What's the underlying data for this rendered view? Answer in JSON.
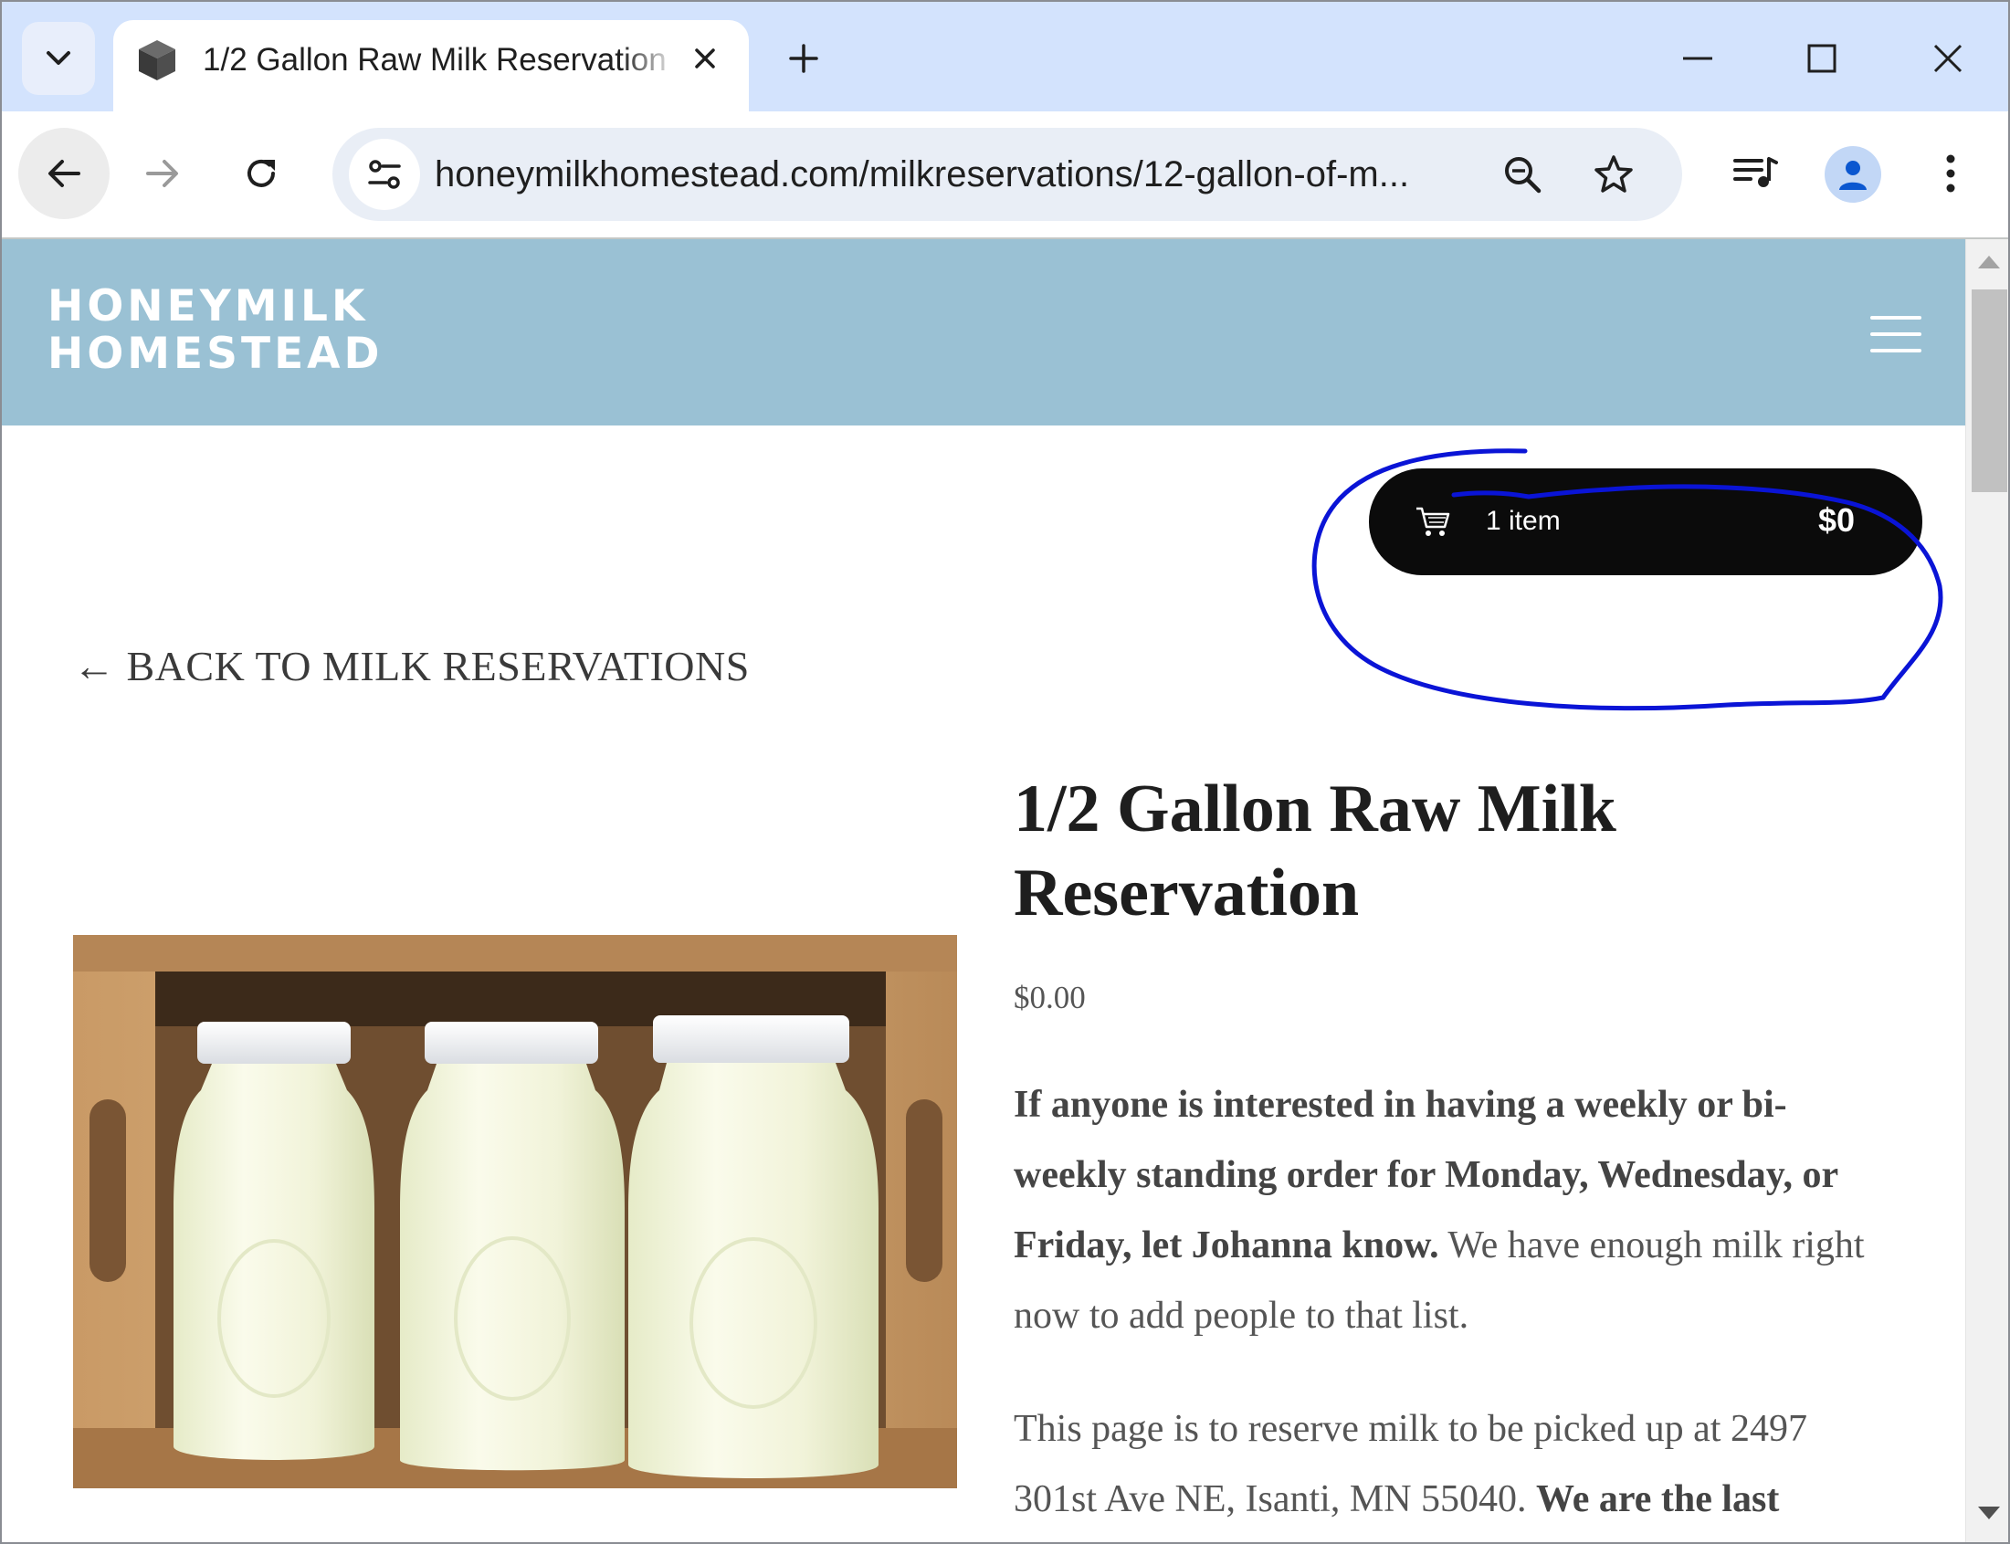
{
  "browser": {
    "tab": {
      "title": "1/2 Gallon Raw Milk Reservation",
      "favicon": "cube-icon"
    },
    "url": "honeymilkhomestead.com/milkreservations/12-gallon-of-m..."
  },
  "site": {
    "brand_line1": "HONEYMILK",
    "brand_line2": "HOMESTEAD",
    "header_color": "#9ac1d4"
  },
  "cart": {
    "count_label": "1 item",
    "total": "$0"
  },
  "back_link": "← BACK TO MILK RESERVATIONS",
  "product": {
    "title": "1/2 Gallon Raw Milk Reservation",
    "price": "$0.00",
    "image_alt": "Three half-gallon jars of raw milk with white lids in a wooden crate",
    "desc1_bold": "If anyone is interested in having a weekly or bi-weekly standing order for Monday, Wednesday, or Friday, let Johanna know.",
    "desc1_rest": " We have enough milk right now to add people to that list.",
    "desc2_text": "This page is to reserve milk to be picked up at 2497 301st Ave NE, Isanti, MN 55040. ",
    "desc2_bold": "We are the last"
  },
  "annotation_color": "#0a14d6"
}
